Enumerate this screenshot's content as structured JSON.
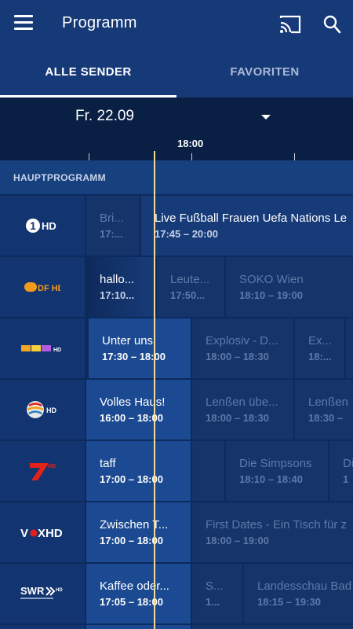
{
  "appbar": {
    "title": "Programm"
  },
  "tabs": [
    {
      "label": "ALLE SENDER"
    },
    {
      "label": "FAVORITEN"
    }
  ],
  "date": {
    "label": "Fr. 22.09"
  },
  "timeline": {
    "label": "18:00"
  },
  "section": {
    "label": "HAUPTPROGRAMM"
  },
  "channels": [
    {
      "logo_text": "1HD",
      "programs": [
        {
          "title": "Bri...",
          "time": "17:..."
        },
        {
          "title": "Live Fußball Frauen Uefa Nations Le",
          "time": "17:45 – 20:00"
        }
      ]
    },
    {
      "logo_text": "2DF HD",
      "programs": [
        {
          "title": "hallo...",
          "time": "17:10..."
        },
        {
          "title": "Leute...",
          "time": "17:50..."
        },
        {
          "title": "SOKO Wien",
          "time": "18:10 – 19:00"
        }
      ]
    },
    {
      "logo_text": "RTL HD",
      "programs": [
        {
          "title": "Unter uns",
          "time": "17:30 – 18:00"
        },
        {
          "title": "Explosiv - D...",
          "time": "18:00 – 18:30"
        },
        {
          "title": "Ex...",
          "time": "18:..."
        }
      ]
    },
    {
      "logo_text": "SAT.1 HD",
      "programs": [
        {
          "title": "Volles Haus!",
          "time": "16:00 – 18:00"
        },
        {
          "title": "Lenßen übe...",
          "time": "18:00 – 18:30"
        },
        {
          "title": "Lenßen",
          "time": "18:30 –"
        }
      ]
    },
    {
      "logo_text": "7 HD",
      "programs": [
        {
          "title": "taff",
          "time": "17:00 – 18:00"
        },
        {
          "title": "Die Simpsons",
          "time": "18:10 – 18:40"
        },
        {
          "title": "Di",
          "time": "1"
        }
      ]
    },
    {
      "logo_text": "VOX HD",
      "programs": [
        {
          "title": "Zwischen T...",
          "time": "17:00 – 18:00"
        },
        {
          "title": "First Dates - Ein Tisch für z",
          "time": "18:00 – 19:00"
        }
      ]
    },
    {
      "logo_text": "SWR HD",
      "programs": [
        {
          "title": "Kaffee oder...",
          "time": "17:05 – 18:00"
        },
        {
          "title": "S...",
          "time": "1..."
        },
        {
          "title": "Landesschau Bad",
          "time": "18:15 – 19:30"
        }
      ]
    }
  ]
}
